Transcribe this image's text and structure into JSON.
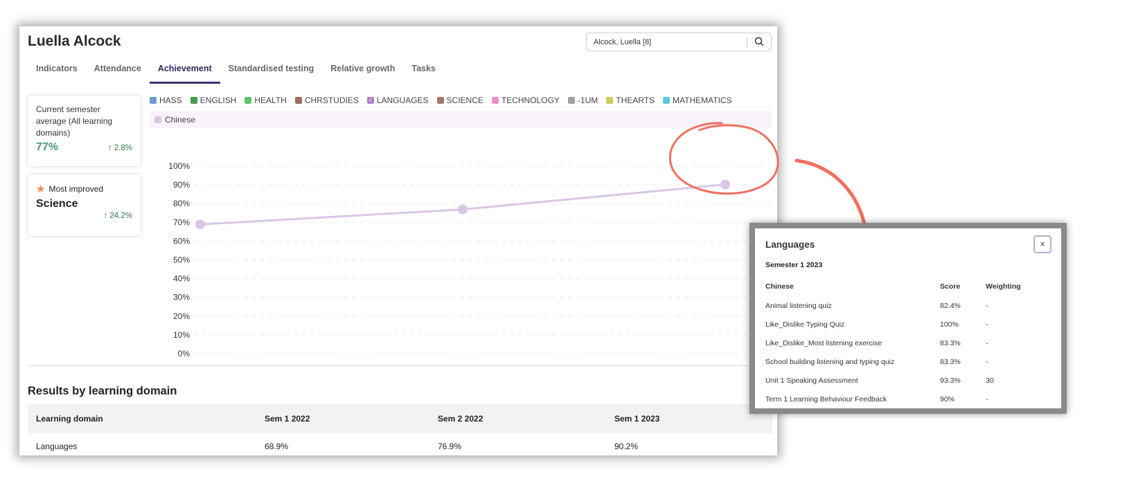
{
  "student_name": "Luella Alcock",
  "search": {
    "value": "Alcock, Luella [8]",
    "icon": "search-icon"
  },
  "tabs": [
    {
      "label": "Indicators"
    },
    {
      "label": "Attendance"
    },
    {
      "label": "Achievement",
      "active": true
    },
    {
      "label": "Standardised testing"
    },
    {
      "label": "Relative growth"
    },
    {
      "label": "Tasks"
    }
  ],
  "stats": {
    "average": {
      "label": "Current semester average (All learning domains)",
      "value": "77%",
      "change": "2.8%"
    },
    "improved": {
      "label": "Most improved",
      "value": "Science",
      "change": "24.2%",
      "icon": "star-icon"
    }
  },
  "legend": [
    {
      "label": "HASS",
      "color": "#6c9bd2"
    },
    {
      "label": "ENGLISH",
      "color": "#3f9e4f"
    },
    {
      "label": "HEALTH",
      "color": "#5cc46a"
    },
    {
      "label": "CHRSTUDIES",
      "color": "#9b6e5a"
    },
    {
      "label": "LANGUAGES",
      "color": "#b07cd0",
      "checked": true
    },
    {
      "label": "SCIENCE",
      "color": "#a8756b"
    },
    {
      "label": "TECHNOLOGY",
      "color": "#ef90c8"
    },
    {
      "label": "-1UM",
      "color": "#a0a0a0"
    },
    {
      "label": "THEARTS",
      "color": "#c9cc5f"
    },
    {
      "label": "MATHEMATICS",
      "color": "#5ecbdc"
    }
  ],
  "sub_legend": {
    "label": "Chinese",
    "color": "#d9c4e4"
  },
  "chart_data": {
    "type": "line",
    "categories": [
      "Sem 1 2022",
      "Sem 2 2022",
      "Sem 1 2023"
    ],
    "series": [
      {
        "name": "Chinese",
        "values": [
          68.9,
          76.9,
          90.2
        ],
        "color": "#dac6e6"
      }
    ],
    "yticks": [
      "100%",
      "90%",
      "80%",
      "70%",
      "60%",
      "50%",
      "40%",
      "30%",
      "20%",
      "10%",
      "0%"
    ],
    "ylim": [
      0,
      100
    ],
    "grid": true
  },
  "results": {
    "title": "Results by learning domain",
    "headers": [
      "Learning domain",
      "Sem 1 2022",
      "Sem 2 2022",
      "Sem 1 2023"
    ],
    "rows": [
      [
        "Languages",
        "68.9%",
        "76.9%",
        "90.2%"
      ]
    ]
  },
  "popup": {
    "title": "Languages",
    "semester": "Semester 1 2023",
    "close": "×",
    "headers": [
      "Chinese",
      "Score",
      "Weighting"
    ],
    "rows": [
      [
        "Animal listening quiz",
        "82.4%",
        "-"
      ],
      [
        "Like_Dislike Typing Quiz",
        "100%",
        "-"
      ],
      [
        "Like_Dislike_Most listening exercise",
        "83.3%",
        "-"
      ],
      [
        "School building listening and typing quiz",
        "83.3%",
        "-"
      ],
      [
        "Unit 1 Speaking Assessment",
        "93.3%",
        "30"
      ],
      [
        "Term 1 Learning Behaviour Feedback",
        "90%",
        "-"
      ]
    ]
  },
  "annotation_color": "#f07060"
}
